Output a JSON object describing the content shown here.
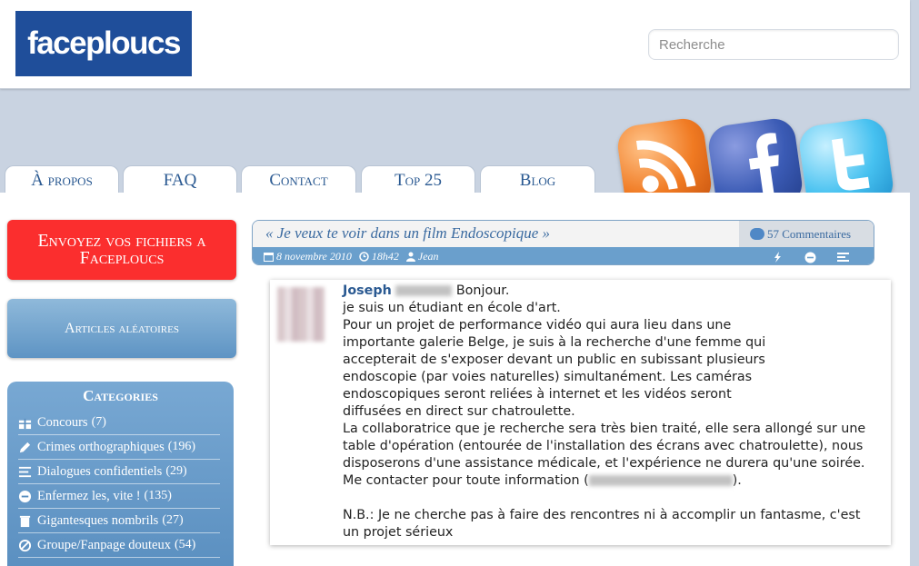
{
  "site": {
    "logo": "faceploucs"
  },
  "search": {
    "placeholder": "Recherche"
  },
  "nav": {
    "tabs": [
      "À propos",
      "FAQ",
      "Contact",
      "Top 25",
      "Blog"
    ]
  },
  "sidebar": {
    "send_files": "Envoyez vos fichiers a Faceploucs",
    "random_articles": "Articles aléatoires",
    "categories_title": "Categories",
    "categories": [
      {
        "label": "Concours",
        "count": "(7)",
        "icon": "gift-icon"
      },
      {
        "label": "Crimes orthographiques",
        "count": "(196)",
        "icon": "pencil-icon"
      },
      {
        "label": "Dialogues confidentiels",
        "count": "(29)",
        "icon": "lines-icon"
      },
      {
        "label": "Enfermez les, vite !",
        "count": "(135)",
        "icon": "minus-circle-icon"
      },
      {
        "label": "Gigantesques nombrils",
        "count": "(27)",
        "icon": "trash-icon"
      },
      {
        "label": "Groupe/Fanpage douteux",
        "count": "(54)",
        "icon": "no-entry-icon"
      }
    ]
  },
  "article": {
    "title": "« Je veux te voir dans un film Endoscopique »",
    "comments_count": "57",
    "comments_label": "Commentaires",
    "date": "8 novembre 2010",
    "time": "18h42",
    "author": "Jean"
  },
  "post": {
    "author": "Joseph",
    "lines": [
      "Bonjour.",
      "je suis un étudiant en école d'art.",
      "Pour un projet de performance vidéo qui aura lieu dans une",
      "importante galerie Belge, je suis à la recherche d'une femme qui",
      "accepterait de s'exposer devant un public en subissant plusieurs",
      "endoscopie (par voies naturelles) simultanément. Les caméras",
      "endoscopiques seront reliées à internet et les vidéos seront",
      "diffusées en direct sur chatroulette.",
      "La collaboratrice que je recherche sera très bien traité, elle sera allongé sur une",
      "table d'opération (entourée de l'installation des écrans avec chatroulette), nous",
      "disposerons d'une assistance médicale, et l'expérience ne durera qu'une soirée.",
      "Me contacter pour toute information (",
      "N.B.: Je ne cherche pas à faire des rencontres ni à accomplir un fantasme, c'est",
      "un projet sérieux"
    ],
    "contact_close": ")."
  }
}
